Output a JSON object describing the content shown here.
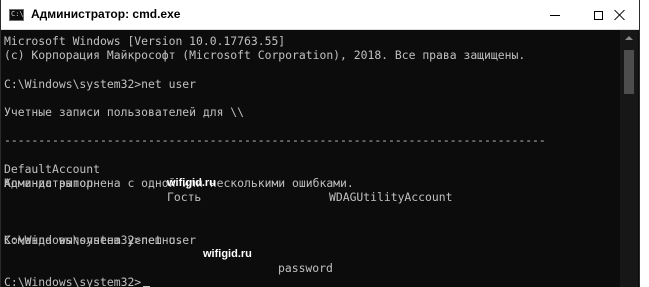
{
  "window": {
    "title": "Администратор: cmd.exe",
    "icon": "cmd-icon",
    "icon_text": "C:\\"
  },
  "console": {
    "lines": {
      "l0": "Microsoft Windows [Version 10.0.17763.55]",
      "l1": "(c) Корпорация Майкрософт (Microsoft Corporation), 2018. Все права защищены.",
      "l2": "",
      "l3": "C:\\Windows\\system32>net user",
      "l4": "",
      "l5": "Учетные записи пользователей для \\\\",
      "l6": "",
      "l7": "-------------------------------------------------------------------------------",
      "l8": "",
      "l9": "",
      "l10": "Команда выполнена с одной или несколькими ошибками.",
      "l11": "",
      "l12": "",
      "l13": "",
      "l14": "Команда выполнена успешно.",
      "l15": "",
      "l16": "",
      "l17": "C:\\Windows\\system32>"
    },
    "accounts": {
      "row1": [
        "DefaultAccount",
        "wifigid.ru",
        "WDAGUtilityAccount"
      ],
      "row2": [
        "Администратор",
        "Гость"
      ]
    },
    "second_command": {
      "prompt": "C:\\Windows\\system32>net user",
      "user": "wifigid.ru",
      "password": "password"
    }
  },
  "colors": {
    "background": "#0c0c0c",
    "text": "#c0c0c0",
    "highlight": "#ffffff"
  }
}
